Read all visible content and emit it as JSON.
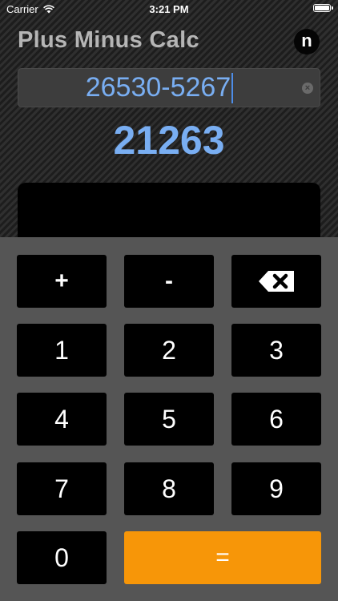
{
  "status_bar": {
    "carrier": "Carrier",
    "time": "3:21 PM",
    "wifi_icon": "wifi-icon",
    "battery_icon": "battery-icon"
  },
  "header": {
    "title": "Plus Minus Calc",
    "app_icon_letter": "n"
  },
  "input": {
    "value": "26530-5267",
    "clear_icon": "clear-circle-icon"
  },
  "result": {
    "value": "21263"
  },
  "keypad": {
    "plus": "+",
    "minus": "-",
    "backspace_icon": "backspace-icon",
    "digits": [
      "1",
      "2",
      "3",
      "4",
      "5",
      "6",
      "7",
      "8",
      "9",
      "0"
    ],
    "equals": "="
  },
  "colors": {
    "accent_blue": "#79aef2",
    "equals_orange": "#f79608",
    "key_background": "#000000",
    "keypad_background": "#555555"
  }
}
